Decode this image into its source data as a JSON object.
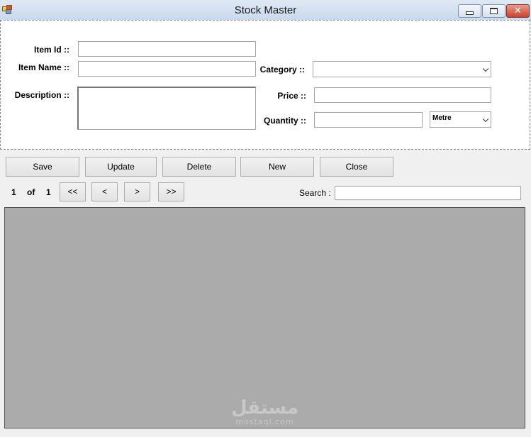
{
  "window": {
    "title": "Stock Master",
    "minimize_icon": "minimize-icon",
    "maximize_icon": "maximize-icon",
    "close_icon": "close-icon",
    "close_glyph": "✕"
  },
  "form": {
    "item_id_label": "Item Id ::",
    "item_id_value": "",
    "item_name_label": "Item Name ::",
    "item_name_value": "",
    "description_label": "Description ::",
    "description_value": "",
    "category_label": "Category ::",
    "category_value": "",
    "price_label": "Price ::",
    "price_value": "",
    "quantity_label": "Quantity ::",
    "quantity_value": "",
    "unit_value": "Metre"
  },
  "actions": {
    "save": "Save",
    "update": "Update",
    "delete": "Delete",
    "new": "New",
    "close": "Close"
  },
  "pager": {
    "current": "1",
    "of": "of",
    "total": "1",
    "first": "<<",
    "prev": "<",
    "next": ">",
    "last": ">>"
  },
  "search": {
    "label": "Search :",
    "value": ""
  },
  "watermark": {
    "arabic": "مستقل",
    "latin": "mostaql.com"
  }
}
